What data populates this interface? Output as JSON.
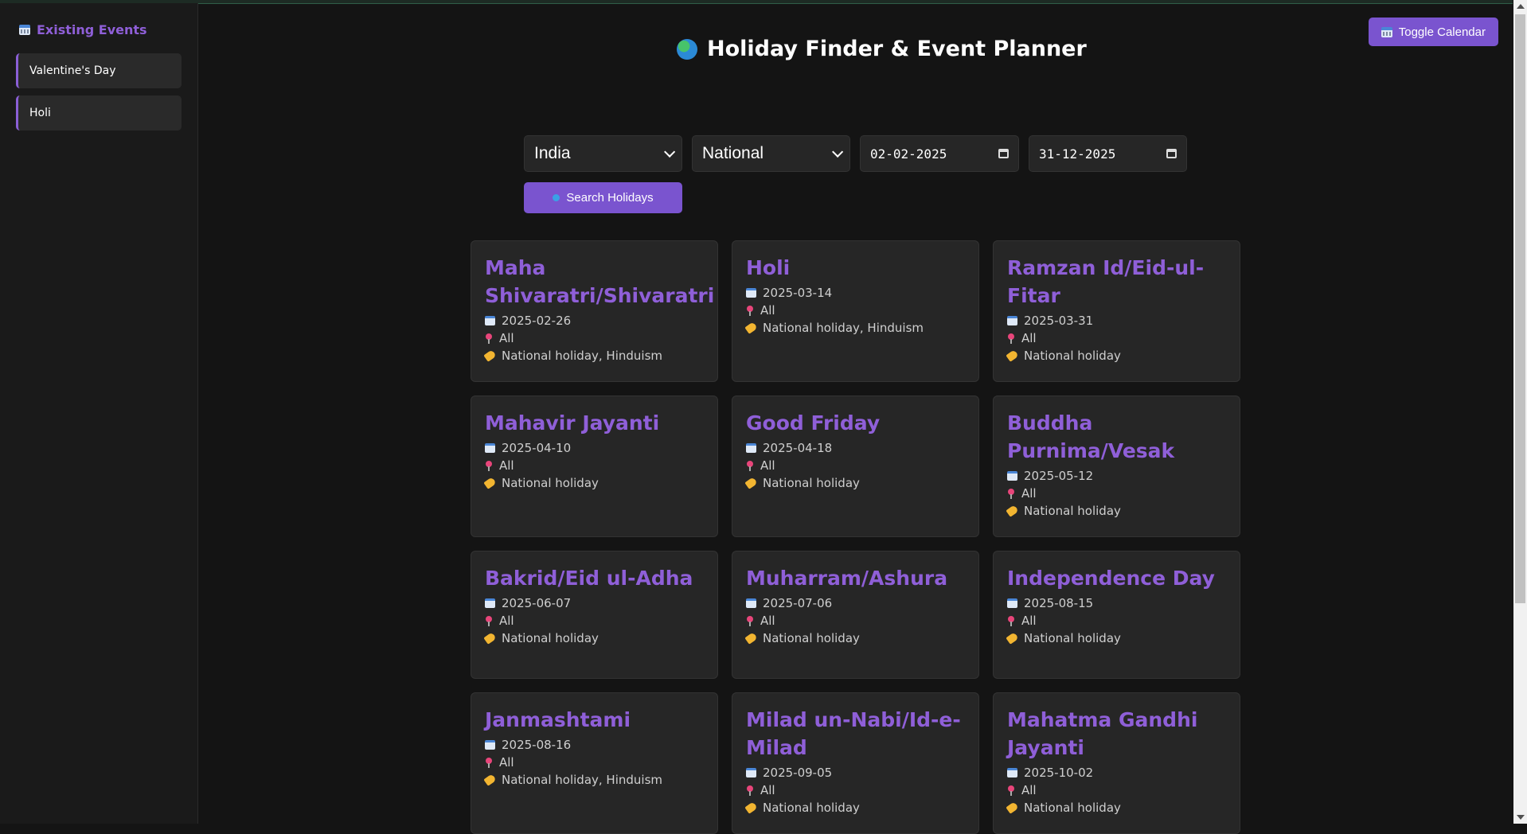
{
  "sidebar": {
    "title": "Existing Events",
    "items": [
      {
        "label": "Valentine's Day"
      },
      {
        "label": "Holi"
      }
    ]
  },
  "header": {
    "title": "Holiday Finder & Event Planner",
    "toggle_calendar_label": "Toggle Calendar"
  },
  "filters": {
    "country": "India",
    "type": "National",
    "start_date": "02-02-2025",
    "end_date": "31-12-2025",
    "search_label": "Search Holidays"
  },
  "holidays": [
    {
      "name": "Maha Shivaratri/Shivaratri",
      "date": "2025-02-26",
      "location": "All",
      "type": "National holiday, Hinduism"
    },
    {
      "name": "Holi",
      "date": "2025-03-14",
      "location": "All",
      "type": "National holiday, Hinduism"
    },
    {
      "name": "Ramzan Id/Eid-ul-Fitar",
      "date": "2025-03-31",
      "location": "All",
      "type": "National holiday"
    },
    {
      "name": "Mahavir Jayanti",
      "date": "2025-04-10",
      "location": "All",
      "type": "National holiday"
    },
    {
      "name": "Good Friday",
      "date": "2025-04-18",
      "location": "All",
      "type": "National holiday"
    },
    {
      "name": "Buddha Purnima/Vesak",
      "date": "2025-05-12",
      "location": "All",
      "type": "National holiday"
    },
    {
      "name": "Bakrid/Eid ul-Adha",
      "date": "2025-06-07",
      "location": "All",
      "type": "National holiday"
    },
    {
      "name": "Muharram/Ashura",
      "date": "2025-07-06",
      "location": "All",
      "type": "National holiday"
    },
    {
      "name": "Independence Day",
      "date": "2025-08-15",
      "location": "All",
      "type": "National holiday"
    },
    {
      "name": "Janmashtami",
      "date": "2025-08-16",
      "location": "All",
      "type": "National holiday, Hinduism"
    },
    {
      "name": "Milad un-Nabi/Id-e-Milad",
      "date": "2025-09-05",
      "location": "All",
      "type": "National holiday"
    },
    {
      "name": "Mahatma Gandhi Jayanti",
      "date": "2025-10-02",
      "location": "All",
      "type": "National holiday"
    }
  ]
}
